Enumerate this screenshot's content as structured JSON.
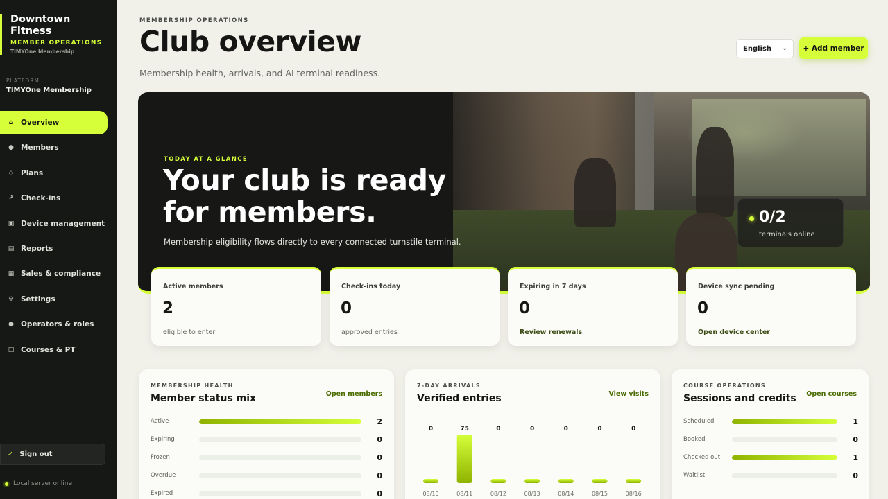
{
  "sidebar": {
    "brand_name": "Downtown Fitness",
    "brand_sub": "MEMBER OPERATIONS",
    "brand_sub2": "TIMYOne Membership",
    "platform_label": "PLATFORM",
    "platform_value": "TIMYOne Membership",
    "items": [
      {
        "label": "Overview",
        "icon": "home-icon",
        "active": true
      },
      {
        "label": "Members",
        "icon": "dot-icon"
      },
      {
        "label": "Plans",
        "icon": "diamond-icon"
      },
      {
        "label": "Check-ins",
        "icon": "arrow-icon"
      },
      {
        "label": "Device management",
        "icon": "device-icon"
      },
      {
        "label": "Reports",
        "icon": "report-icon"
      },
      {
        "label": "Sales & compliance",
        "icon": "sales-icon"
      },
      {
        "label": "Settings",
        "icon": "gear-icon"
      },
      {
        "label": "Operators & roles",
        "icon": "dot-icon"
      },
      {
        "label": "Courses & PT",
        "icon": "square-icon"
      }
    ],
    "signout_label": "Sign out",
    "server_status": "Local server online"
  },
  "header": {
    "eyebrow": "MEMBERSHIP OPERATIONS",
    "title": "Club overview",
    "subtitle": "Membership health, arrivals, and AI terminal readiness.",
    "language": "English",
    "add_member": "+ Add member"
  },
  "hero": {
    "eyebrow": "TODAY AT A GLANCE",
    "title": "Your club is ready for members.",
    "description": "Membership eligibility flows directly to every connected turnstile terminal.",
    "terminals_value": "0/2",
    "terminals_label": "terminals online"
  },
  "kpis": [
    {
      "label": "Active members",
      "value": "2",
      "sub": "eligible to enter"
    },
    {
      "label": "Check-ins today",
      "value": "0",
      "sub": "approved entries"
    },
    {
      "label": "Expiring in 7 days",
      "value": "0",
      "link": "Review renewals"
    },
    {
      "label": "Device sync pending",
      "value": "0",
      "link": "Open device center"
    }
  ],
  "membership_health": {
    "eyebrow": "MEMBERSHIP HEALTH",
    "title": "Member status mix",
    "link": "Open members",
    "rows": [
      {
        "label": "Active",
        "count": "2",
        "fraction": 1.0
      },
      {
        "label": "Expiring",
        "count": "0",
        "fraction": 0
      },
      {
        "label": "Frozen",
        "count": "0",
        "fraction": 0
      },
      {
        "label": "Overdue",
        "count": "0",
        "fraction": 0
      },
      {
        "label": "Expired",
        "count": "0",
        "fraction": 0
      }
    ]
  },
  "arrivals": {
    "eyebrow": "7-DAY ARRIVALS",
    "title": "Verified entries",
    "link": "View visits"
  },
  "courses": {
    "eyebrow": "COURSE OPERATIONS",
    "title": "Sessions and credits",
    "link": "Open courses",
    "rows": [
      {
        "label": "Scheduled",
        "count": "1",
        "fraction": 1.0
      },
      {
        "label": "Booked",
        "count": "0",
        "fraction": 0
      },
      {
        "label": "Checked out",
        "count": "1",
        "fraction": 1.0
      },
      {
        "label": "Waitlist",
        "count": "0",
        "fraction": 0
      }
    ]
  },
  "chart_data": {
    "type": "bar",
    "categories": [
      "08/10",
      "08/11",
      "08/12",
      "08/13",
      "08/14",
      "08/15",
      "08/16"
    ],
    "values": [
      0,
      75,
      0,
      0,
      0,
      0,
      0
    ],
    "title": "Verified entries",
    "ylim": [
      0,
      75
    ],
    "grid": false
  },
  "colors": {
    "accent": "#d6ff3a",
    "sidebar_bg": "#161816",
    "page_bg": "#f1f1ea"
  }
}
